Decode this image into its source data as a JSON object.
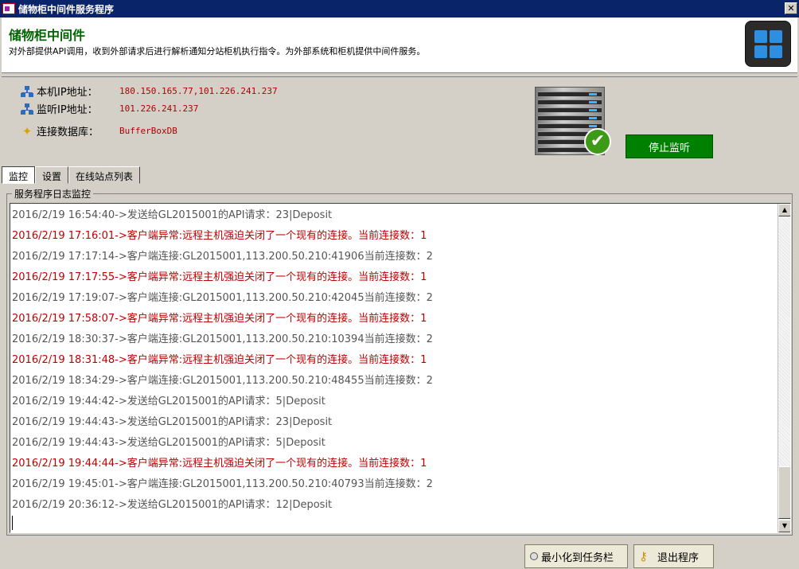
{
  "window": {
    "title": "储物柜中间件服务程序",
    "close_glyph": "✕"
  },
  "banner": {
    "heading": "储物柜中间件",
    "description": "对外部提供API调用，收到外部请求后进行解析通知分站柜机执行指令。为外部系统和柜机提供中间件服务。"
  },
  "info": {
    "local_ip_label": "本机IP地址：",
    "local_ip_value": "180.150.165.77,101.226.241.237",
    "listen_ip_label": "监听IP地址：",
    "listen_ip_value": "101.226.241.237",
    "db_label": "连接数据库：",
    "db_value": "BufferBoxDB",
    "stop_button": "停止监听"
  },
  "tabs": [
    {
      "label": "监控",
      "active": true
    },
    {
      "label": "设置",
      "active": false
    },
    {
      "label": "在线站点列表",
      "active": false
    }
  ],
  "log": {
    "group_title": "服务程序日志监控",
    "lines": [
      {
        "text": "2016/2/19 16:54:40->发送给GL2015001的API请求：23|Deposit",
        "level": "normal"
      },
      {
        "text": "2016/2/19 17:16:01->客户端异常:远程主机强迫关闭了一个现有的连接。当前连接数：1",
        "level": "error"
      },
      {
        "text": "2016/2/19 17:17:14->客户端连接:GL2015001,113.200.50.210:41906当前连接数：2",
        "level": "normal"
      },
      {
        "text": "2016/2/19 17:17:55->客户端异常:远程主机强迫关闭了一个现有的连接。当前连接数：1",
        "level": "error"
      },
      {
        "text": "2016/2/19 17:19:07->客户端连接:GL2015001,113.200.50.210:42045当前连接数：2",
        "level": "normal"
      },
      {
        "text": "2016/2/19 17:58:07->客户端异常:远程主机强迫关闭了一个现有的连接。当前连接数：1",
        "level": "error"
      },
      {
        "text": "2016/2/19 18:30:37->客户端连接:GL2015001,113.200.50.210:10394当前连接数：2",
        "level": "normal"
      },
      {
        "text": "2016/2/19 18:31:48->客户端异常:远程主机强迫关闭了一个现有的连接。当前连接数：1",
        "level": "error"
      },
      {
        "text": "2016/2/19 18:34:29->客户端连接:GL2015001,113.200.50.210:48455当前连接数：2",
        "level": "normal"
      },
      {
        "text": "2016/2/19 19:44:42->发送给GL2015001的API请求：5|Deposit",
        "level": "normal"
      },
      {
        "text": "2016/2/19 19:44:43->发送给GL2015001的API请求：23|Deposit",
        "level": "normal"
      },
      {
        "text": "2016/2/19 19:44:43->发送给GL2015001的API请求：5|Deposit",
        "level": "normal"
      },
      {
        "text": "2016/2/19 19:44:44->客户端异常:远程主机强迫关闭了一个现有的连接。当前连接数：1",
        "level": "error"
      },
      {
        "text": "2016/2/19 19:45:01->客户端连接:GL2015001,113.200.50.210:40793当前连接数：2",
        "level": "normal"
      },
      {
        "text": "2016/2/19 20:36:12->发送给GL2015001的API请求：12|Deposit",
        "level": "normal"
      }
    ]
  },
  "buttons": {
    "minimize_label": "最小化到任务栏",
    "exit_label": "退出程序"
  },
  "colors": {
    "title_bar": "#0a246a",
    "heading": "#006400",
    "value_text": "#b00000",
    "stop_button": "#008000",
    "log_error": "#c00000",
    "log_normal": "#555555"
  },
  "icons": {
    "app": "app-icon",
    "network": "network-icon",
    "database": "star-icon",
    "server": "server-icon",
    "check": "checkmark-icon",
    "logo": "grid-logo-icon",
    "minimize": "radio-icon",
    "exit": "key-icon"
  }
}
